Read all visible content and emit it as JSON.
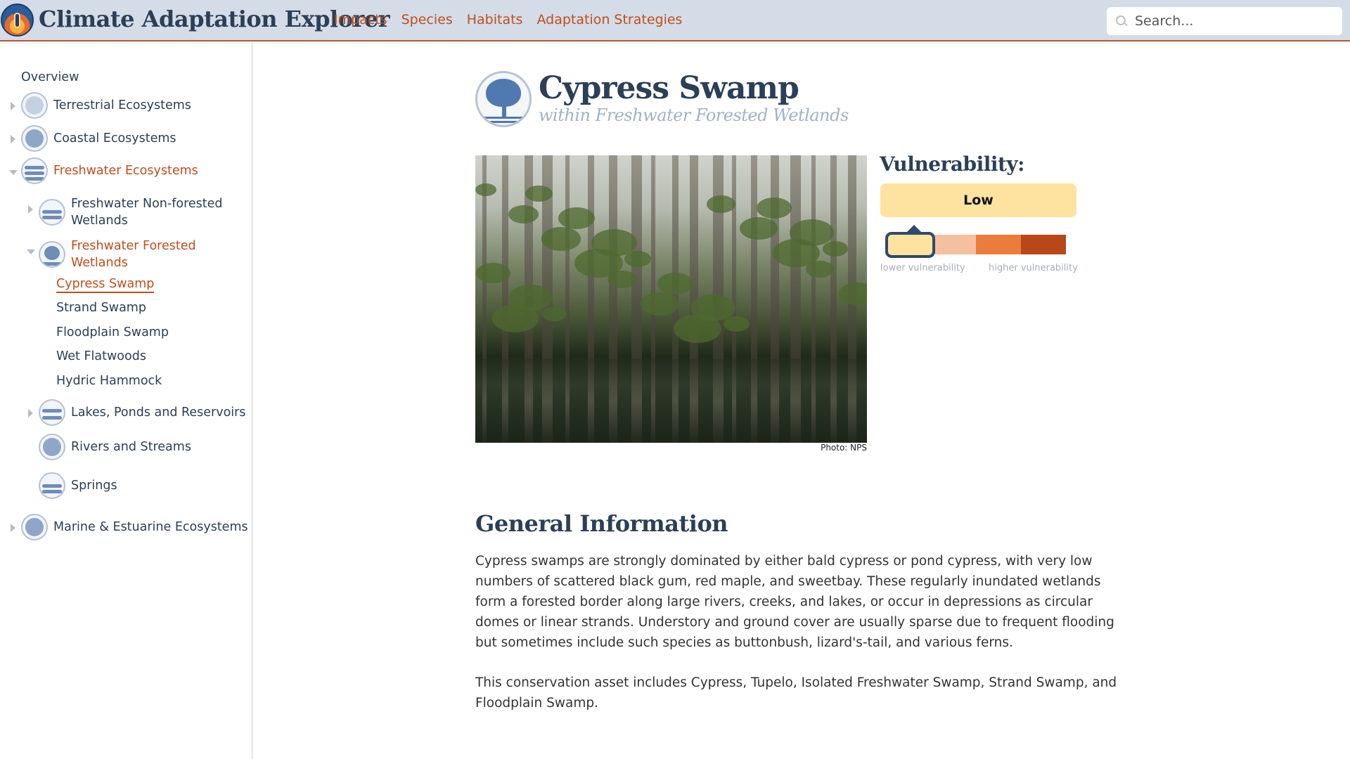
{
  "app": {
    "title": "Climate Adaptation Explorer"
  },
  "nav": [
    "Impacts",
    "Species",
    "Habitats",
    "Adaptation Strategies"
  ],
  "search": {
    "placeholder": "Search..."
  },
  "sidebar": {
    "overview": "Overview",
    "terrestrial": "Terrestrial Ecosystems",
    "coastal": "Coastal Ecosystems",
    "freshwater": "Freshwater Ecosystems",
    "non_forested": "Freshwater Non-forested Wetlands",
    "forested": "Freshwater Forested Wetlands",
    "forested_children": [
      "Cypress Swamp",
      "Strand Swamp",
      "Floodplain Swamp",
      "Wet Flatwoods",
      "Hydric Hammock"
    ],
    "lakes": "Lakes, Ponds and Reservoirs",
    "rivers": "Rivers and Streams",
    "springs": "Springs",
    "marine": "Marine & Estuarine Ecosystems"
  },
  "page": {
    "title": "Cypress Swamp",
    "subtitle": "within Freshwater Forested Wetlands",
    "photo_credit": "Photo: NPS"
  },
  "vulnerability": {
    "heading": "Vulnerability:",
    "level": "Low",
    "scale_colors": [
      "#fde39f",
      "#f5c0a0",
      "#ea7d3c",
      "#b9471a"
    ],
    "level_index": 0,
    "low_label": "lower vulnerability",
    "high_label": "higher vulnerability"
  },
  "general": {
    "heading": "General Information",
    "para1": "Cypress swamps are strongly dominated by either bald cypress or pond cypress, with very low numbers of scattered black gum, red maple, and sweetbay. These regularly inundated wetlands form a forested border along large rivers, creeks, and lakes, or occur in depressions as circular domes or linear strands. Understory and ground cover are usually sparse due to frequent flooding but sometimes include such species as buttonbush, lizard's-tail, and various ferns.",
    "para2": "This conservation asset includes Cypress, Tupelo, Isolated Freshwater Swamp, Strand Swamp, and Floodplain Swamp."
  }
}
